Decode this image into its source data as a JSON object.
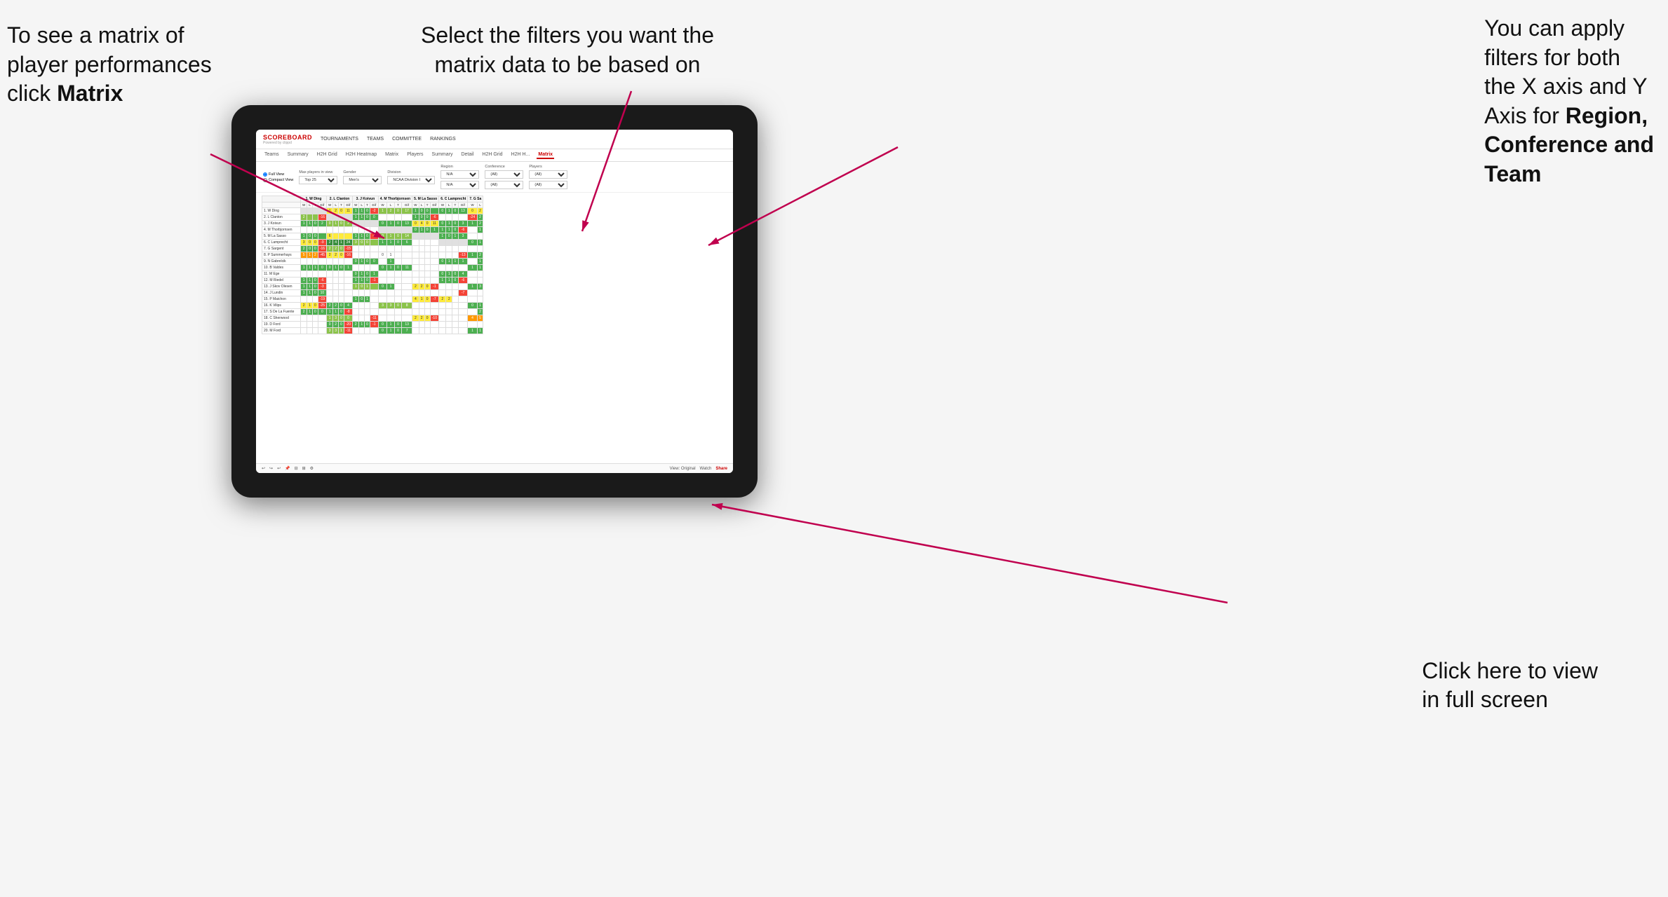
{
  "annotations": {
    "top_left": {
      "line1": "To see a matrix of",
      "line2": "player performances",
      "line3_normal": "click ",
      "line3_bold": "Matrix"
    },
    "top_center": {
      "line1": "Select the filters you want the",
      "line2": "matrix data to be based on"
    },
    "top_right": {
      "line1": "You  can apply",
      "line2": "filters for both",
      "line3": "the X axis and Y",
      "line4_normal": "Axis for ",
      "line4_bold": "Region,",
      "line5_bold": "Conference and",
      "line6_bold": "Team"
    },
    "bottom_right": {
      "line1": "Click here to view",
      "line2": "in full screen"
    }
  },
  "app": {
    "logo": "SCOREBOARD",
    "logo_sub": "Powered by clippd",
    "nav_items": [
      "TOURNAMENTS",
      "TEAMS",
      "COMMITTEE",
      "RANKINGS"
    ],
    "sub_nav": [
      "Teams",
      "Summary",
      "H2H Grid",
      "H2H Heatmap",
      "Matrix",
      "Players",
      "Summary",
      "Detail",
      "H2H Grid",
      "H2HH...",
      "Matrix"
    ],
    "active_tab": "Matrix",
    "filters": {
      "view_options": [
        "Full View",
        "Compact View"
      ],
      "max_players_label": "Max players in view",
      "max_players_value": "Top 25",
      "gender_label": "Gender",
      "gender_value": "Men's",
      "division_label": "Division",
      "division_value": "NCAA Division I",
      "region_label": "Region",
      "region_value": "N/A",
      "conference_label": "Conference",
      "conference_value": "(All)",
      "players_label": "Players",
      "players_value": "(All)"
    },
    "col_headers": [
      "1. W Ding",
      "2. L Clanton",
      "3. J Koivun",
      "4. M Thorbjornsen",
      "5. M La Sasso",
      "6. C Lamprecht",
      "7. G Sa"
    ],
    "sub_cols": [
      "W",
      "L",
      "T",
      "Dif"
    ],
    "rows": [
      {
        "name": "1. W Ding",
        "cells": [
          "",
          "",
          "",
          "",
          "1",
          "2",
          "0",
          "11",
          "1",
          "1",
          "0",
          "-2",
          "1",
          "2",
          "0",
          "17",
          "1",
          "0",
          "0",
          "",
          "0",
          "1",
          "0",
          "13",
          "0",
          "2"
        ]
      },
      {
        "name": "2. L Clanton",
        "cells": [
          "2",
          "",
          "",
          "",
          "",
          "",
          "",
          "",
          "1",
          "1",
          "0",
          "0",
          "",
          "",
          "",
          "",
          "1",
          "0",
          "0",
          "-6",
          "",
          "",
          "",
          "",
          "-24",
          "2",
          "2"
        ]
      },
      {
        "name": "3. J Koivun",
        "cells": [
          "1",
          "1",
          "0",
          "2",
          "0",
          "1",
          "0",
          "2",
          "",
          "",
          "",
          "",
          "0",
          "1",
          "0",
          "13",
          "0",
          "4",
          "0",
          "11",
          "0",
          "1",
          "0",
          "3",
          "1",
          "2"
        ]
      },
      {
        "name": "4. M Thorbjornsen",
        "cells": [
          "",
          "",
          "",
          "",
          "",
          "",
          "",
          "",
          "",
          "",
          "",
          "",
          "",
          "",
          "",
          "",
          "0",
          "1",
          "0",
          "1",
          "1",
          "1",
          "0",
          "-6",
          "",
          "1"
        ]
      },
      {
        "name": "5. M La Sasso",
        "cells": [
          "1",
          "0",
          "0",
          "",
          "6",
          "",
          "",
          "",
          "1",
          "1",
          "0",
          "-1",
          "0",
          "1",
          "0",
          "14",
          "",
          "",
          "",
          "",
          "1",
          "0",
          "1",
          "3",
          "",
          ""
        ]
      },
      {
        "name": "6. C Lamprecht",
        "cells": [
          "3",
          "0",
          "0",
          "-9",
          "2",
          "4",
          "1",
          "24",
          "3",
          "0",
          "0",
          "",
          "1",
          "1",
          "0",
          "6",
          "",
          "",
          "",
          "",
          "",
          "",
          "",
          "",
          "0",
          "1"
        ]
      },
      {
        "name": "7. G Sargent",
        "cells": [
          "2",
          "0",
          "0",
          "-16",
          "2",
          "2",
          "0",
          "-15",
          "",
          "",
          "",
          "",
          "",
          "",
          "",
          "",
          "",
          "",
          "",
          "",
          "",
          "",
          "",
          "",
          "",
          ""
        ]
      },
      {
        "name": "8. P Summerhays",
        "cells": [
          "5",
          "1",
          "2",
          "-45",
          "2",
          "2",
          "0",
          "-16",
          "",
          "",
          "",
          "",
          "0",
          "1",
          "",
          "",
          "",
          "",
          "",
          "",
          "",
          "",
          "",
          "",
          "-13",
          "1",
          "2"
        ]
      },
      {
        "name": "9. N Gabrelcik",
        "cells": [
          "",
          "",
          "",
          "",
          "",
          "",
          "",
          "",
          "0",
          "1",
          "0",
          "0",
          "",
          "1",
          "",
          "",
          "",
          "",
          "",
          "",
          "0",
          "1",
          "1",
          "1",
          "",
          "1"
        ]
      },
      {
        "name": "10. B Valdes",
        "cells": [
          "1",
          "1",
          "1",
          "0",
          "0",
          "1",
          "0",
          "1",
          "",
          "",
          "",
          "",
          "0",
          "1",
          "0",
          "11",
          "",
          "",
          "",
          "",
          "",
          "",
          "",
          "",
          "1",
          "1"
        ]
      },
      {
        "name": "11. M Ege",
        "cells": [
          "",
          "",
          "",
          "",
          "",
          "",
          "",
          "",
          "0",
          "1",
          "0",
          "1",
          "",
          "",
          "",
          "",
          "",
          "",
          "",
          "",
          "0",
          "1",
          "0",
          "4",
          "",
          ""
        ]
      },
      {
        "name": "12. M Riedel",
        "cells": [
          "1",
          "1",
          "0",
          "-6",
          "",
          "",
          "",
          "",
          "1",
          "1",
          "0",
          "-1",
          "",
          "",
          "",
          "",
          "",
          "",
          "",
          "",
          "1",
          "1",
          "0",
          "-6",
          "",
          ""
        ]
      },
      {
        "name": "13. J Skov Olesen",
        "cells": [
          "1",
          "1",
          "0",
          "-3",
          "",
          "",
          "",
          "",
          "1",
          "0",
          "1",
          "",
          "0",
          "1",
          "",
          "",
          "2",
          "2",
          "0",
          "-1",
          "",
          "",
          "",
          "",
          "1",
          "3"
        ]
      },
      {
        "name": "14. J Lundin",
        "cells": [
          "1",
          "1",
          "0",
          "10",
          "",
          "",
          "",
          "",
          "",
          "",
          "",
          "",
          "",
          "",
          "",
          "",
          "",
          "",
          "",
          "",
          "-7",
          "",
          "",
          "",
          "",
          ""
        ]
      },
      {
        "name": "15. P Maichon",
        "cells": [
          "",
          "",
          "",
          "",
          "-19",
          "",
          "",
          "",
          "1",
          "0",
          "1",
          "",
          "",
          "",
          "",
          "",
          "4",
          "1",
          "0",
          "-7",
          "2",
          "2"
        ]
      },
      {
        "name": "16. K Vilips",
        "cells": [
          "2",
          "1",
          "0",
          "-25",
          "2",
          "2",
          "0",
          "4",
          "",
          "",
          "",
          "",
          "3",
          "3",
          "0",
          "8",
          "",
          "",
          "",
          "",
          "",
          "",
          "",
          "",
          "0",
          "1"
        ]
      },
      {
        "name": "17. S De La Fuente",
        "cells": [
          "2",
          "1",
          "0",
          "0",
          "1",
          "1",
          "0",
          "-8",
          "",
          "",
          "",
          "",
          "",
          "",
          "",
          "",
          "",
          "",
          "",
          "",
          "",
          "",
          "",
          "",
          "",
          "2"
        ]
      },
      {
        "name": "18. C Sherwood",
        "cells": [
          "",
          "",
          "",
          "",
          "1",
          "3",
          "0",
          "0",
          "",
          "",
          "",
          "",
          "-11",
          "",
          "",
          "",
          "2",
          "2",
          "0",
          "-10",
          "",
          "",
          "",
          "",
          "4",
          "5"
        ]
      },
      {
        "name": "19. D Ford",
        "cells": [
          "",
          "",
          "",
          "",
          "0",
          "2",
          "0",
          "-20",
          "2",
          "1",
          "0",
          "-1",
          "0",
          "1",
          "0",
          "13",
          "",
          "",
          "",
          "",
          "",
          "",
          "",
          "",
          "",
          ""
        ]
      },
      {
        "name": "20. M Ford",
        "cells": [
          "",
          "",
          "",
          "",
          "3",
          "3",
          "1",
          "-11",
          "",
          "",
          "",
          "",
          "0",
          "1",
          "0",
          "7",
          "",
          "",
          "",
          "",
          "",
          "",
          "",
          "",
          "1",
          "1"
        ]
      }
    ]
  },
  "bottom_toolbar": {
    "view_label": "View: Original",
    "watch_label": "Watch",
    "share_label": "Share"
  }
}
